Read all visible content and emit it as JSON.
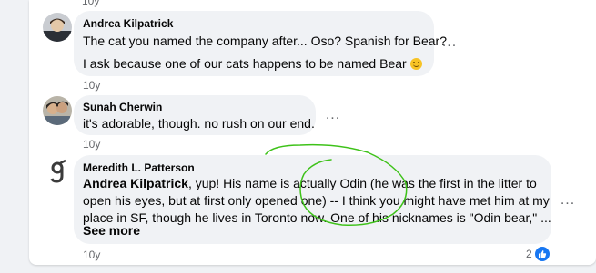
{
  "thread": {
    "top_time": "10y",
    "comments": [
      {
        "author": "Andrea Kilpatrick",
        "lines": [
          "The cat you named the company after... Oso? Spanish for Bear?",
          "I ask because one of our cats happens to be named Bear"
        ],
        "emoji": "smiling-face-emoji",
        "time": "10y",
        "more": "..."
      },
      {
        "author": "Sunah Cherwin",
        "lines": [
          "it's adorable, though. no rush on our end."
        ],
        "time": "10y",
        "more": "..."
      },
      {
        "author": "Meredith L. Patterson",
        "mention": "Andrea Kilpatrick",
        "lines": [
          ", yup! His name is actually Odin (he was the first in the litter to",
          "open his eyes, but at first only opened one) -- I think you might have met him at my",
          "place in SF, though he lives in Toronto now. One of his nicknames is \"Odin bear,\" ..."
        ],
        "see_more": "See more",
        "time": "10y",
        "more": "...",
        "reaction_count": "2",
        "reaction_icon": "like-icon"
      }
    ],
    "annotation_color": "#3ec219",
    "accent_color": "#1877f2"
  }
}
